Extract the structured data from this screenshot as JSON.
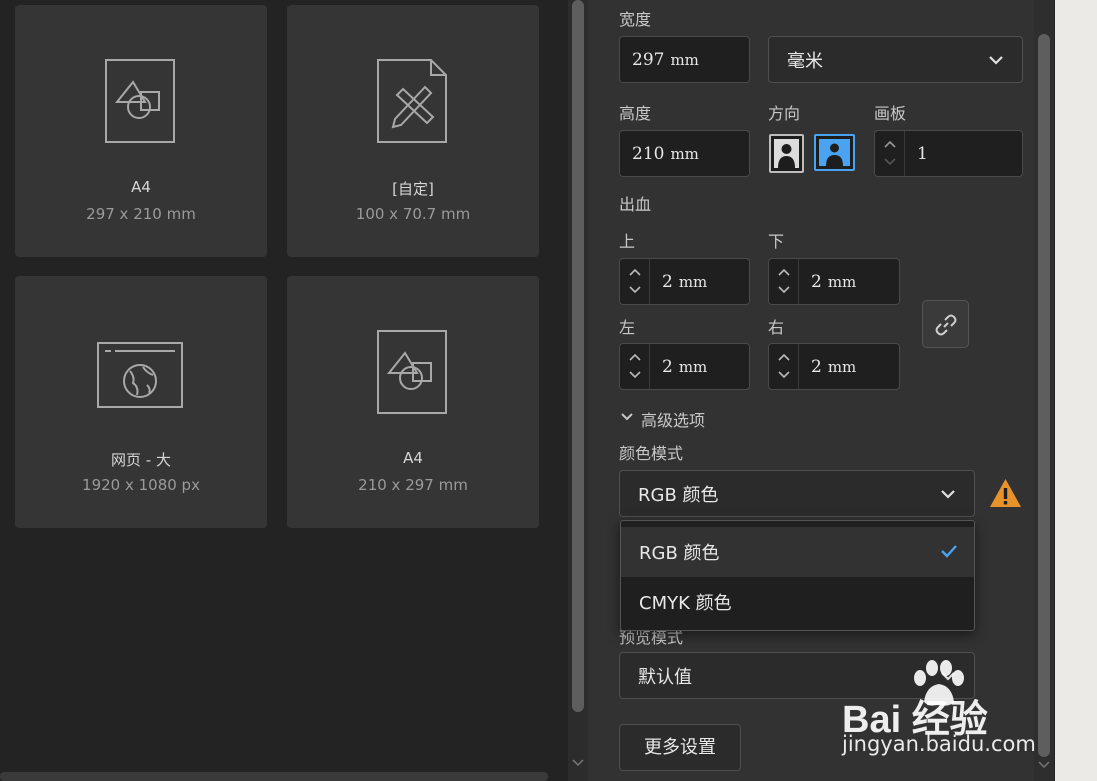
{
  "presets": [
    {
      "name": "A4",
      "size": "297 x 210 mm",
      "icon": "document-shapes-icon"
    },
    {
      "name": "[自定]",
      "size": "100 x 70.7 mm",
      "icon": "document-pencil-ruler-icon"
    },
    {
      "name": "网页 - 大",
      "size": "1920 x 1080 px",
      "icon": "web-globe-icon"
    },
    {
      "name": "A4",
      "size": "210 x 297 mm",
      "icon": "document-shapes-icon"
    }
  ],
  "settings": {
    "width_label": "宽度",
    "width_value": "297",
    "width_unit": "mm",
    "unit_select": "毫米",
    "height_label": "高度",
    "height_value": "210",
    "height_unit": "mm",
    "orientation_label": "方向",
    "artboard_label": "画板",
    "artboard_value": "1",
    "bleed_label": "出血",
    "bleed_top_label": "上",
    "bleed_top_value": "2",
    "bleed_bottom_label": "下",
    "bleed_bottom_value": "2",
    "bleed_left_label": "左",
    "bleed_left_value": "2",
    "bleed_right_label": "右",
    "bleed_right_value": "2",
    "bleed_unit": "mm",
    "advanced_label": "高级选项",
    "color_mode_label": "颜色模式",
    "color_mode_value": "RGB 颜色",
    "color_mode_options": [
      "RGB 颜色",
      "CMYK 颜色"
    ],
    "preview_mode_label": "预览模式",
    "preview_mode_value": "默认值",
    "more_settings": "更多设置"
  },
  "watermark": {
    "brand": "Bai 经验",
    "url": "jingyan.baidu.com"
  },
  "colors": {
    "accent": "#4aa3f0",
    "warning": "#e8922a",
    "panel": "#323232",
    "card": "#353535"
  }
}
